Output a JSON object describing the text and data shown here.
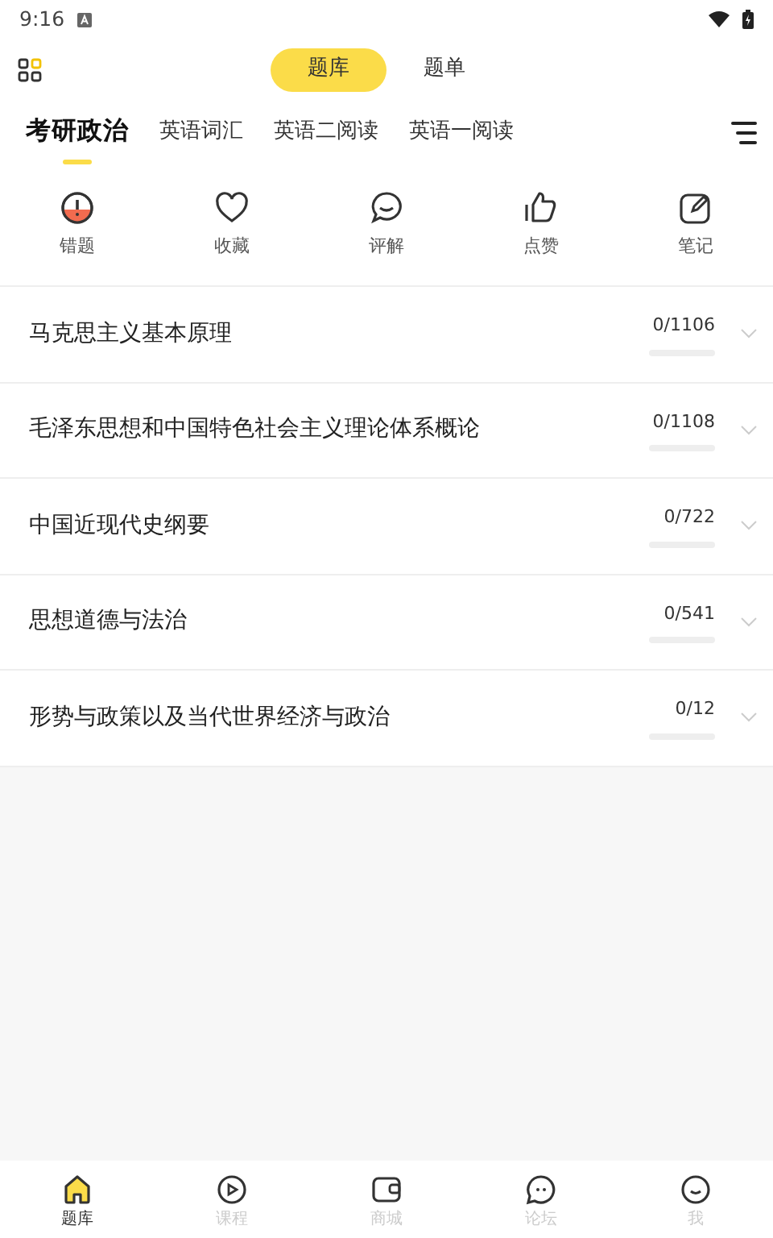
{
  "status_bar": {
    "time": "9:16"
  },
  "segments": [
    {
      "label": "题库",
      "selected": true
    },
    {
      "label": "题单",
      "selected": false
    }
  ],
  "tabs": [
    {
      "label": "考研政治",
      "selected": true
    },
    {
      "label": "英语词汇",
      "selected": false
    },
    {
      "label": "英语二阅读",
      "selected": false
    },
    {
      "label": "英语一阅读",
      "selected": false
    }
  ],
  "shortcuts": [
    {
      "kind": "wrong",
      "label": "错题"
    },
    {
      "kind": "favorite",
      "label": "收藏"
    },
    {
      "kind": "comment",
      "label": "评解"
    },
    {
      "kind": "like",
      "label": "点赞"
    },
    {
      "kind": "note",
      "label": "笔记"
    }
  ],
  "subjects": [
    {
      "title": "马克思主义基本原理",
      "count": "0/1106",
      "level": 0
    },
    {
      "title": "毛泽东思想和中国特色社会主义理论体系概论",
      "count": "0/1108",
      "level": 0
    },
    {
      "title": "中国近现代史纲要",
      "count": "0/722",
      "level": 0
    },
    {
      "title": "思想道德与法治",
      "count": "0/541",
      "level": 0
    },
    {
      "title": "形势与政策以及当代世界经济与政治",
      "count": "0/12",
      "level": 0
    }
  ],
  "bottom_nav": [
    {
      "kind": "home",
      "label": "题库",
      "selected": true
    },
    {
      "kind": "play",
      "label": "课程",
      "selected": false
    },
    {
      "kind": "wallet",
      "label": "商城",
      "selected": false
    },
    {
      "kind": "chat",
      "label": "论坛",
      "selected": false
    },
    {
      "kind": "face",
      "label": "我",
      "selected": false
    }
  ]
}
